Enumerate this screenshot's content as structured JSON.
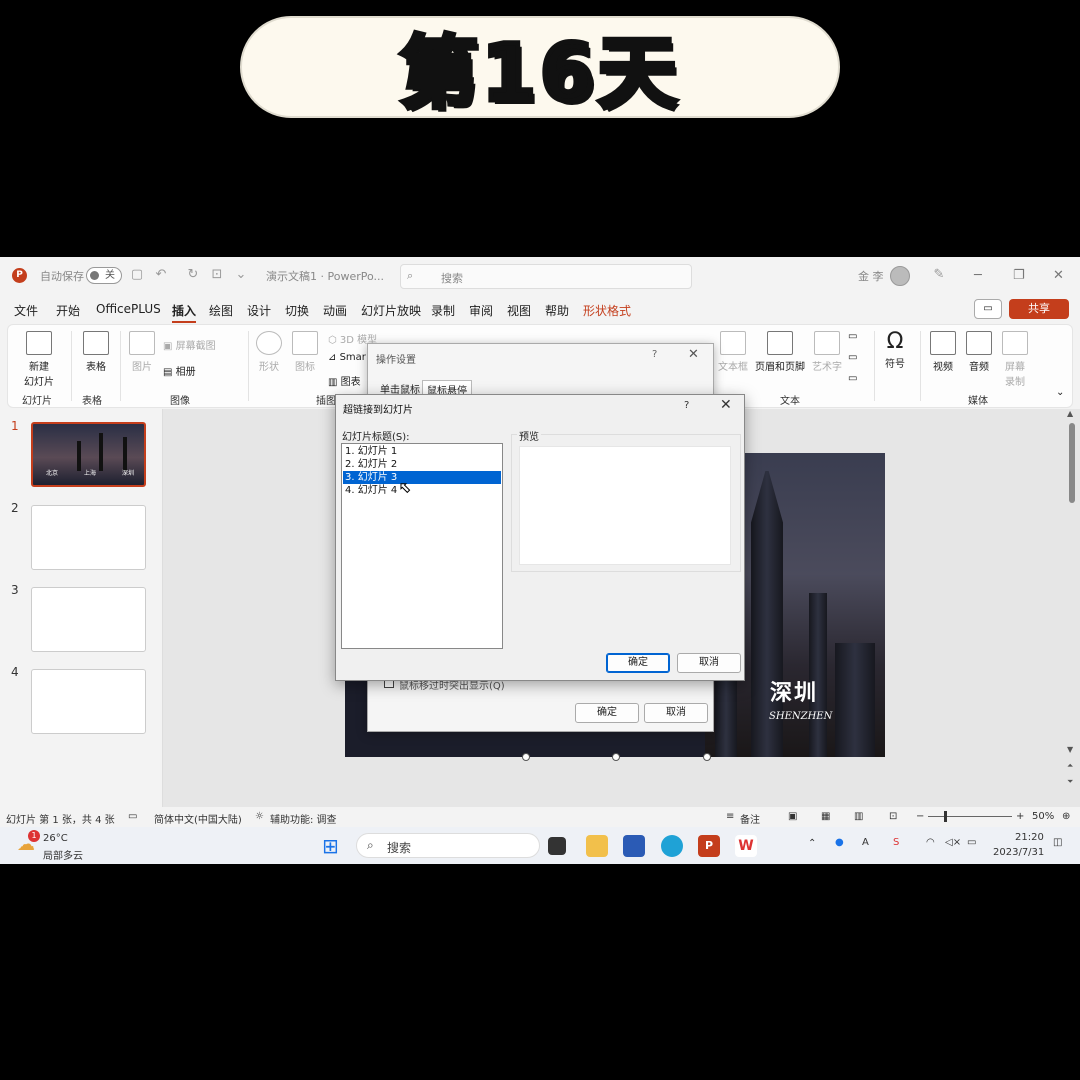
{
  "banner": {
    "text": "第16天"
  },
  "titlebar": {
    "autosave_label": "自动保存",
    "autosave_state": "关",
    "doc_title": "演示文稿1 · PowerPo...",
    "search_placeholder": "搜索",
    "user_name": "金 李",
    "icons": [
      "powerpoint-logo",
      "save-icon",
      "undo-icon",
      "redo-icon",
      "present-icon",
      "customize-icon",
      "pen-icon"
    ]
  },
  "menu": {
    "items": [
      "文件",
      "开始",
      "OfficePLUS",
      "插入",
      "绘图",
      "设计",
      "切换",
      "动画",
      "幻灯片放映",
      "录制",
      "审阅",
      "视图",
      "帮助",
      "形状格式"
    ],
    "active": "插入",
    "share_label": "共享"
  },
  "ribbon": {
    "new_slide": "新建\n幻灯片",
    "table": "表格",
    "image": "图片",
    "screenshot": "屏幕截图",
    "album": "相册",
    "shape": "形状",
    "icons_label": "图标",
    "model3d": "3D 模型",
    "smartart": "Smar",
    "chart": "图表",
    "textbox": "文本框",
    "header_footer": "页眉和页脚",
    "wordart": "艺术字",
    "symbol": "符号",
    "video": "视频",
    "audio": "音频",
    "screen_record": "屏幕\n录制",
    "groups": {
      "slides": "幻灯片",
      "tables": "表格",
      "images": "图像",
      "illustrations": "插图",
      "text": "文本",
      "media": "媒体"
    }
  },
  "thumbnails": [
    {
      "num": "1",
      "cities": [
        "北京",
        "上海",
        "深圳"
      ]
    },
    {
      "num": "2"
    },
    {
      "num": "3"
    },
    {
      "num": "4"
    }
  ],
  "slide": {
    "city": "深圳",
    "city_en": "SHENZHEN"
  },
  "back_dialog": {
    "title": "操作设置",
    "help": "?",
    "tabs": [
      "单击鼠标",
      "鼠标悬停"
    ],
    "checkbox_label": "鼠标移过时突出显示(Q)",
    "ok": "确定",
    "cancel": "取消"
  },
  "dialog": {
    "title": "超链接到幻灯片",
    "help": "?",
    "list_label": "幻灯片标题(S):",
    "items": [
      "1. 幻灯片 1",
      "2. 幻灯片 2",
      "3. 幻灯片 3",
      "4. 幻灯片 4"
    ],
    "selected_index": 2,
    "preview_label": "预览",
    "ok": "确定",
    "cancel": "取消"
  },
  "statusbar": {
    "slide_info": "幻灯片 第 1 张，共 4 张",
    "language": "简体中文(中国大陆)",
    "accessibility": "辅助功能: 调查",
    "notes": "备注",
    "zoom": "50%"
  },
  "taskbar": {
    "weather_temp": "26°C",
    "weather_desc": "局部多云",
    "weather_badge": "1",
    "search": "搜索",
    "time": "21:20",
    "date": "2023/7/31"
  }
}
